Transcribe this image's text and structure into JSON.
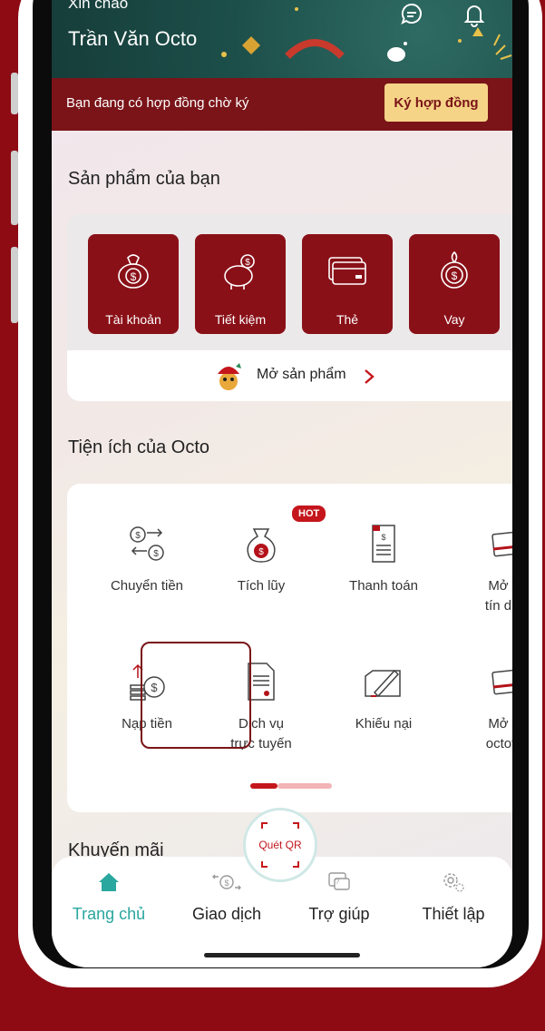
{
  "header": {
    "greeting": "Xin chào",
    "user_name": "Trần Văn Octo"
  },
  "banner": {
    "text": "Bạn đang có hợp đồng chờ ký",
    "button_label": "Ký hợp đồng"
  },
  "products": {
    "title": "Sản phẩm của bạn",
    "items": [
      {
        "label": "Tài khoản",
        "icon": "money-bag-icon"
      },
      {
        "label": "Tiết kiệm",
        "icon": "piggy-bank-icon"
      },
      {
        "label": "Thẻ",
        "icon": "card-icon"
      },
      {
        "label": "Vay",
        "icon": "loan-icon"
      }
    ],
    "open_label": "Mở sản phẩm"
  },
  "utilities": {
    "title": "Tiện ích của Octo",
    "hot_badge": "HOT",
    "items": [
      {
        "label": "Chuyển tiền",
        "icon": "transfer-icon"
      },
      {
        "label": "Tích lũy",
        "icon": "savings-bag-icon"
      },
      {
        "label": "Thanh toán",
        "icon": "bill-icon"
      },
      {
        "label": "Mở thẻ",
        "label2": "tín dụng",
        "icon": "credit-card-icon"
      },
      {
        "label": "Nạp tiền",
        "icon": "top-up-icon"
      },
      {
        "label": "Dịch vụ",
        "label2": "trực tuyến",
        "icon": "document-icon"
      },
      {
        "label": "Khiếu nại",
        "icon": "complaint-icon"
      },
      {
        "label": "Mở thẻ",
        "label2": "octofast",
        "icon": "fast-card-icon"
      }
    ]
  },
  "promotions": {
    "title": "Khuyến mãi"
  },
  "tabbar": {
    "qr_label": "Quét QR",
    "tabs": [
      {
        "label": "Trang chủ",
        "icon": "home-icon",
        "active": true
      },
      {
        "label": "Giao dịch",
        "icon": "transaction-icon"
      },
      {
        "label": "Trợ giúp",
        "icon": "help-icon"
      },
      {
        "label": "Thiết lập",
        "icon": "settings-icon"
      }
    ]
  },
  "colors": {
    "brand": "#8a1018",
    "accent": "#2aa79e",
    "banner_button": "#f5d488"
  }
}
